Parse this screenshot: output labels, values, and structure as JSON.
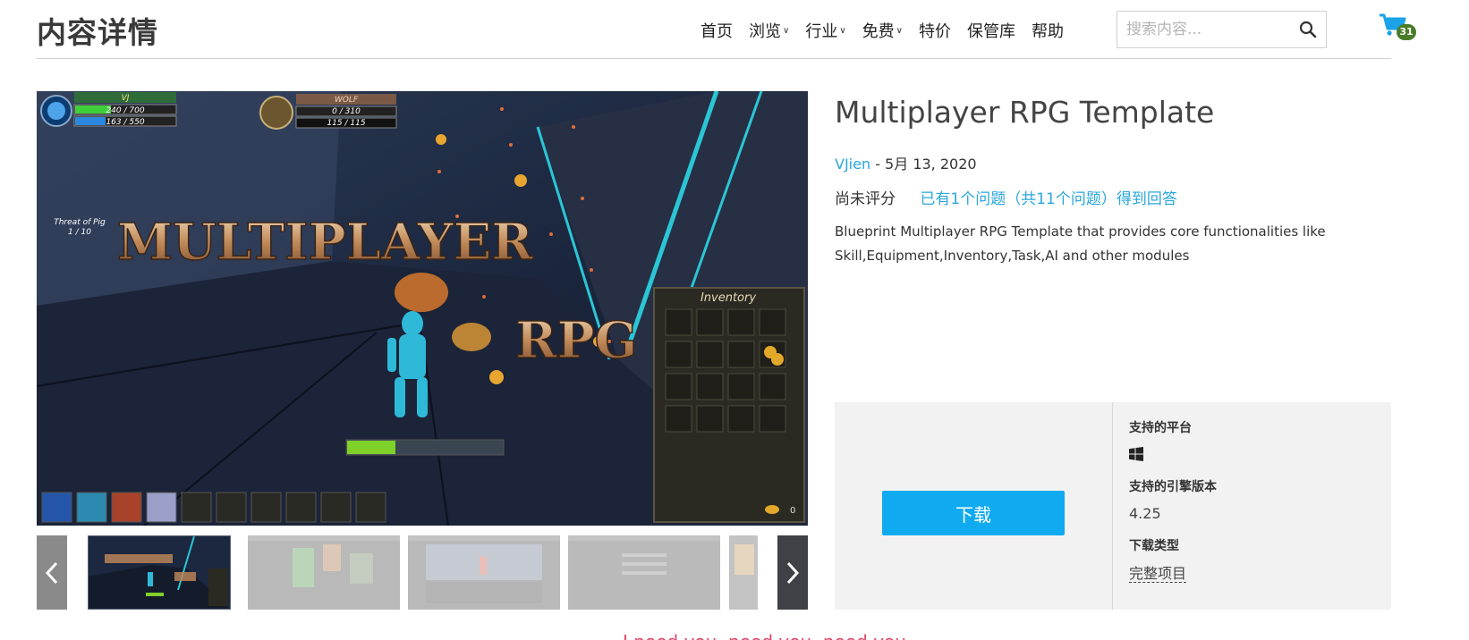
{
  "header": {
    "title": "内容详情",
    "nav": [
      {
        "label": "首页",
        "dropdown": false
      },
      {
        "label": "浏览",
        "dropdown": true
      },
      {
        "label": "行业",
        "dropdown": true
      },
      {
        "label": "免费",
        "dropdown": true
      },
      {
        "label": "特价",
        "dropdown": false
      },
      {
        "label": "保管库",
        "dropdown": false
      },
      {
        "label": "帮助",
        "dropdown": false
      }
    ],
    "search": {
      "placeholder": "搜索内容...",
      "value": ""
    },
    "cart": {
      "count": "31",
      "icon": "shopping-cart-icon"
    }
  },
  "main_image": {
    "hud": {
      "player_name": "VJ",
      "player_hp": "240 / 700",
      "player_mp": "163 / 550",
      "enemy_name": "WOLF",
      "enemy_hp": "0 / 310",
      "enemy_mp": "115 / 115",
      "threat_label": "Threat of Pig",
      "threat_value": "1 / 10",
      "inventory_title": "Inventory",
      "gold": "0"
    },
    "overlay_text": [
      "MULTIPLAYER",
      "RPG"
    ]
  },
  "thumbnails": {
    "count": 5,
    "selected_index": 0
  },
  "product": {
    "title": "Multiplayer RPG Template",
    "author": "VJien",
    "date": "5月 13, 2020",
    "rating": "尚未评分",
    "qa": "已有1个问题（共11个问题）得到回答",
    "description": "Blueprint Multiplayer RPG Template that provides core functionalities like Skill,Equipment,Inventory,Task,AI and other modules"
  },
  "download": {
    "button_label": "下载",
    "platforms_label": "支持的平台",
    "platform_icon": "windows-icon",
    "engine_label": "支持的引擎版本",
    "engine_version": "4.25",
    "type_label": "下载类型",
    "type_value": "完整项目"
  },
  "bottom_peek": "I need you, need you, need you",
  "colors": {
    "accent": "#10aaf0",
    "link": "#29a6db",
    "badge": "#4a7d2a"
  }
}
